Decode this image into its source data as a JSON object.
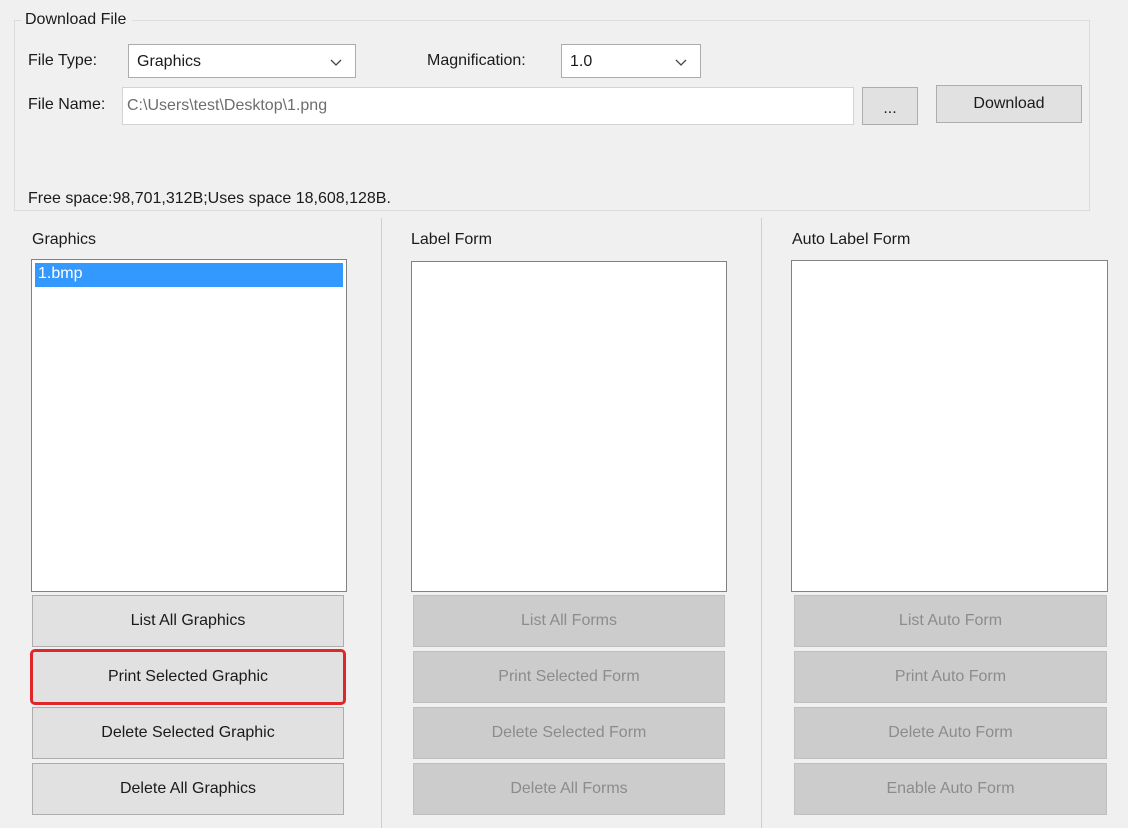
{
  "download": {
    "group_title": "Download File",
    "file_type_label": "File Type:",
    "file_type_value": "Graphics",
    "magnification_label": "Magnification:",
    "magnification_value": "1.0",
    "file_name_label": "File Name:",
    "file_name_value": "C:\\Users\\test\\Desktop\\1.png",
    "browse_label": "...",
    "download_label": "Download",
    "space_info": "Free space:98,701,312B;Uses space 18,608,128B."
  },
  "graphics": {
    "title": "Graphics",
    "items": [
      "1.bmp"
    ],
    "selected_index": 0,
    "buttons": [
      "List All Graphics",
      "Print Selected Graphic",
      "Delete Selected Graphic",
      "Delete All Graphics"
    ],
    "highlighted_button": "Print Selected Graphic"
  },
  "label_form": {
    "title": "Label Form",
    "items": [],
    "buttons": [
      "List All Forms",
      "Print Selected Form",
      "Delete Selected Form",
      "Delete All Forms"
    ]
  },
  "auto_label_form": {
    "title": "Auto Label Form",
    "items": [],
    "buttons": [
      "List Auto Form",
      "Print Auto Form",
      "Delete Auto Form",
      "Enable Auto Form"
    ]
  },
  "colors": {
    "selection": "#3399ff",
    "highlight_border": "#e0252b",
    "disabled_button": "#cccccc"
  },
  "icons": [
    "chevron-down-icon"
  ]
}
